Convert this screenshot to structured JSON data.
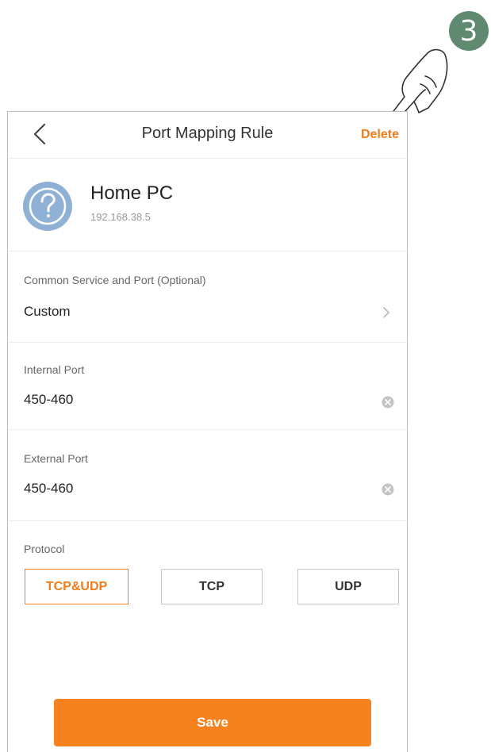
{
  "step_badge": "3",
  "header": {
    "title": "Port Mapping Rule",
    "delete_label": "Delete"
  },
  "device": {
    "name": "Home PC",
    "ip": "192.168.38.5",
    "icon": "question-icon"
  },
  "service": {
    "label": "Common Service and Port (Optional)",
    "value": "Custom"
  },
  "internal_port": {
    "label": "Internal Port",
    "value": "450-460"
  },
  "external_port": {
    "label": "External Port",
    "value": "450-460"
  },
  "protocol": {
    "label": "Protocol",
    "options": [
      "TCP&UDP",
      "TCP",
      "UDP"
    ],
    "selected": "TCP&UDP"
  },
  "save_label": "Save",
  "colors": {
    "accent": "#f07d19",
    "save_button": "#f6821f",
    "badge": "#5f8a6f",
    "avatar": "#8fb1d6"
  }
}
